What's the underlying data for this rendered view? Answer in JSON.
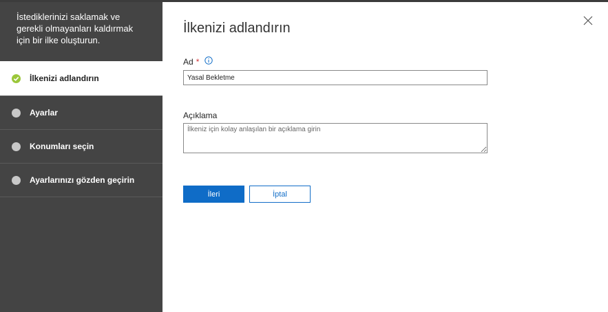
{
  "sidebar": {
    "header_text": "İstediklerinizi saklamak ve gerekli olmayanları kaldırmak için bir ilke oluşturun.",
    "steps": [
      {
        "label": "İlkenizi adlandırın",
        "state": "active"
      },
      {
        "label": "Ayarlar",
        "state": "pending"
      },
      {
        "label": "Konumları seçin",
        "state": "pending"
      },
      {
        "label": "Ayarlarınızı gözden geçirin",
        "state": "pending"
      }
    ]
  },
  "main": {
    "title": "İlkenizi adlandırın",
    "name_field": {
      "label": "Ad",
      "required_mark": "*",
      "value": "Yasal Bekletme"
    },
    "description_field": {
      "label": "Açıklama",
      "placeholder": "İlkeniz için kolay anlaşılan bir açıklama girin"
    },
    "buttons": {
      "next": "İleri",
      "cancel": "İptal"
    }
  },
  "colors": {
    "sidebar_bg": "#444444",
    "accent_blue": "#0f6cc7",
    "active_check": "#9bc73a",
    "pending_dot": "#c8c8c8",
    "required": "#d13438"
  },
  "icons": {
    "close": "close-icon",
    "info": "info-icon",
    "check": "check-icon"
  }
}
